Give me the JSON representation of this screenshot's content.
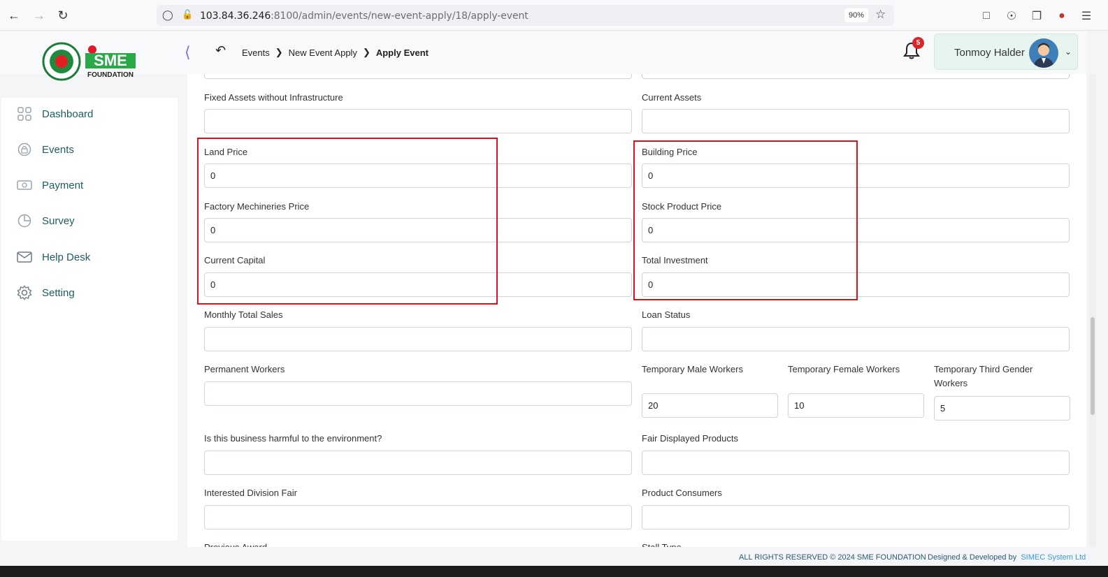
{
  "browser": {
    "url_host": "103.84.36.246",
    "url_rest": ":8100/admin/events/new-event-apply/18/apply-event",
    "zoom": "90%"
  },
  "header": {
    "logo_text": "SME",
    "logo_sub": "FOUNDATION",
    "breadcrumb": [
      "Events",
      "New Event Apply",
      "Apply Event"
    ],
    "notification_count": "5",
    "user_name": "Tonmoy Halder"
  },
  "sidebar": {
    "items": [
      {
        "label": "Dashboard",
        "icon": "grid-icon"
      },
      {
        "label": "Events",
        "icon": "events-icon"
      },
      {
        "label": "Payment",
        "icon": "payment-icon"
      },
      {
        "label": "Survey",
        "icon": "pie-chart-icon"
      },
      {
        "label": "Help Desk",
        "icon": "mail-icon"
      },
      {
        "label": "Setting",
        "icon": "gear-icon"
      }
    ]
  },
  "form": {
    "fixed_assets_label": "Fixed Assets without Infrastructure",
    "current_assets_label": "Current Assets",
    "land_price_label": "Land Price",
    "land_price_value": "0",
    "building_price_label": "Building Price",
    "building_price_value": "0",
    "factory_label": "Factory Mechineries Price",
    "factory_value": "0",
    "stock_label": "Stock Product Price",
    "stock_value": "0",
    "capital_label": "Current Capital",
    "capital_value": "0",
    "total_label": "Total Investment",
    "total_value": "0",
    "monthly_sales_label": "Monthly Total Sales",
    "loan_status_label": "Loan Status",
    "permanent_workers_label": "Permanent Workers",
    "temp_male_label": "Temporary Male Workers",
    "temp_male_value": "20",
    "temp_female_label": "Temporary Female Workers",
    "temp_female_value": "10",
    "temp_third_label": "Temporary Third Gender Workers",
    "temp_third_value": "5",
    "harmful_label": "Is this business harmful to the environment?",
    "fair_products_label": "Fair Displayed Products",
    "division_fair_label": "Interested Division Fair",
    "consumers_label": "Product Consumers",
    "previous_award_label": "Previous Award",
    "stall_type_label": "Stall Type"
  },
  "footer": {
    "rights": "ALL RIGHTS RESERVED © 2024 SME FOUNDATION",
    "designed": "Designed & Developed by",
    "company": "SIMEC System Ltd"
  },
  "colors": {
    "highlight": "#e0101b",
    "sidebar_text": "#1f5c60",
    "user_chip": "#e8f5ef"
  }
}
